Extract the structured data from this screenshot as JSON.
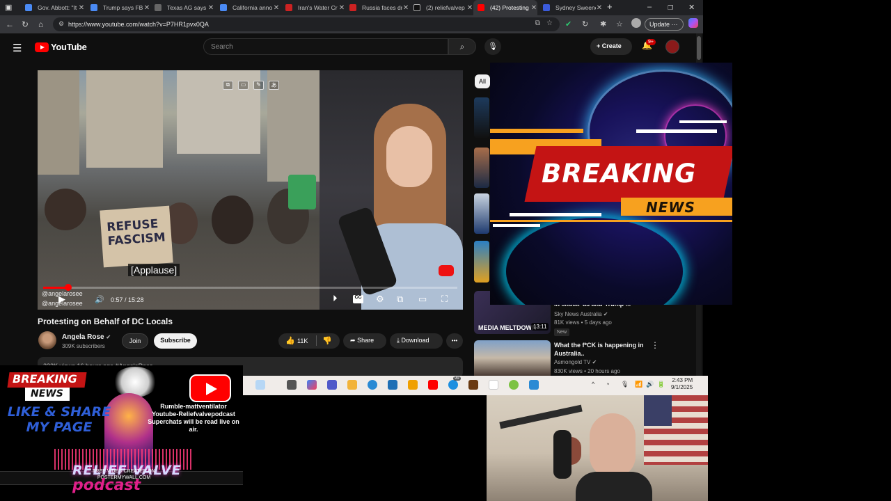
{
  "browser": {
    "tabs": [
      {
        "label": "Gov. Abbott: \"It",
        "fav": "#4a8af4"
      },
      {
        "label": "Trump says FBI",
        "fav": "#4a8af4"
      },
      {
        "label": "Texas AG says",
        "fav": "#666666"
      },
      {
        "label": "California anno",
        "fav": "#4a8af4"
      },
      {
        "label": "Iran's Water Cr",
        "fav": "#cc2222"
      },
      {
        "label": "Russia faces dr",
        "fav": "#cc2222"
      },
      {
        "label": "(2) reliefvalvep",
        "fav": "#111111"
      },
      {
        "label": "(42) Protesting",
        "fav": "#ff0000"
      },
      {
        "label": "Sydney Sweene",
        "fav": "#3b5bdb"
      }
    ],
    "new_tab": "+",
    "win_min": "–",
    "win_max": "❐",
    "win_close": "✕",
    "url": "https://www.youtube.com/watch?v=P7HR1pvx0QA",
    "update_label": "Update"
  },
  "youtube": {
    "logo_text": "YouTube",
    "search_placeholder": "Search",
    "create_label": "Create",
    "notif_count": "9+",
    "player": {
      "caption": "[Applause]",
      "sign_text": "REFUSE FASCISM",
      "time_current": "0:57",
      "time_total": "15:28",
      "time_display": "0:57 / 15:28",
      "progress": 0.061,
      "watermark_ig": "@angelarosee",
      "watermark_x": "@angelarosee"
    },
    "video_title": "Protesting on Behalf of DC Locals",
    "channel_name": "Angela Rose",
    "channel_verified": "✔",
    "channel_subs": "309K subscribers",
    "join_label": "Join",
    "subscribe_label": "Subscribe",
    "likes": "11K",
    "share_label": "Share",
    "download_label": "Download",
    "more_label": "•••",
    "desc_preview": "232K views  16 hours ago  #AngelaRose",
    "chip_all": "All",
    "recommendations": [
      {
        "thumb_caption": "MEDIA MELTDOWN",
        "duration": "13:11",
        "title": "in shock' as anti-Trump ...",
        "channel": "Sky News Australia",
        "meta": "81K views • 5 days ago",
        "badge": "New"
      },
      {
        "title": "What the f*CK is happening in Australia..",
        "channel": "Asmongold TV",
        "meta": "830K views • 20 hours ago"
      }
    ]
  },
  "overlay": {
    "breaking_word": "BREAKING",
    "news_word": "NEWS"
  },
  "taskbar": {
    "time": "2:43 PM",
    "date": "9/1/2025",
    "chevron": "^",
    "notif_count": "99"
  },
  "promo": {
    "breaking": "BREAKING",
    "news": "NEWS",
    "like_share": "LIKE & SHARE MY PAGE",
    "info_line1": "Rumble-mattventilator",
    "info_line2": "Youtube-Reliefvalvepodcast",
    "info_line3": "Superchats will be read live on air.",
    "relief": "RELIEF VALVE",
    "credit_line1": "FREE VIDEO CREATED ON",
    "credit_line2": "POSTERMYWALL.COM",
    "podcast": "podcast"
  },
  "colors": {
    "yt_red": "#ff0000",
    "breaking_red": "#c41414",
    "news_orange": "#f7a11f",
    "like_blue": "#2f5fd8"
  }
}
